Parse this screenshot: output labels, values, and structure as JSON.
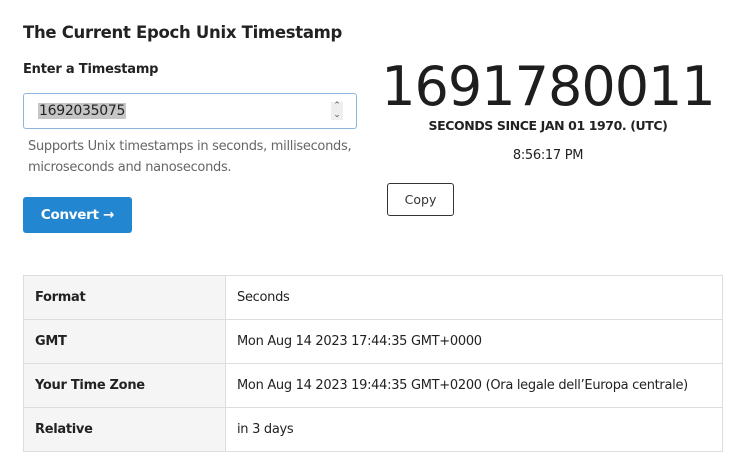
{
  "title": "The Current Epoch Unix Timestamp",
  "input": {
    "label": "Enter a Timestamp",
    "value": "1692035075",
    "help": "Supports Unix timestamps in seconds, milliseconds, microseconds and nanoseconds."
  },
  "convert_label": "Convert →",
  "current": {
    "epoch": "1691780011",
    "caption": "SECONDS SINCE JAN 01 1970. (UTC)",
    "time": "8:56:17 PM",
    "copy_label": "Copy"
  },
  "rows": [
    {
      "key": "Format",
      "value": "Seconds"
    },
    {
      "key": "GMT",
      "value": "Mon Aug 14 2023 17:44:35 GMT+0000"
    },
    {
      "key": "Your Time Zone",
      "value": "Mon Aug 14 2023 19:44:35 GMT+0200 (Ora legale dell’Europa centrale)"
    },
    {
      "key": "Relative",
      "value": "in 3 days"
    }
  ]
}
